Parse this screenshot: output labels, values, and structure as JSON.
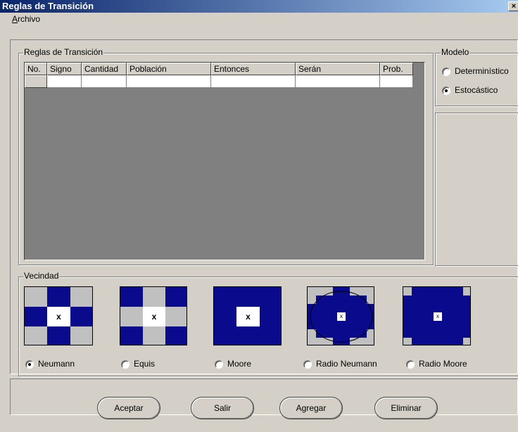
{
  "window": {
    "title": "Reglas de Transición",
    "close_glyph": "×"
  },
  "menu": {
    "archivo_accel": "A",
    "archivo_rest": "rchivo"
  },
  "rules": {
    "legend": "Reglas de Transición",
    "columns": [
      "No.",
      "Signo",
      "Cantidad",
      "Población",
      "Entonces",
      "Serán",
      "Prob."
    ]
  },
  "modelo": {
    "legend": "Modelo",
    "options": [
      {
        "label": "Determinístico",
        "selected": false
      },
      {
        "label": "Estocástico",
        "selected": true
      }
    ]
  },
  "vecindad": {
    "legend": "Vecindad",
    "center_mark": "x",
    "options": [
      {
        "label": "Neumann",
        "selected": true
      },
      {
        "label": "Equis",
        "selected": false
      },
      {
        "label": "Moore",
        "selected": false
      },
      {
        "label": "Radio Neumann",
        "selected": false
      },
      {
        "label": "Radio Moore",
        "selected": false
      }
    ]
  },
  "colors": {
    "blue": "#0a0a8c",
    "grey_cell": "#c0c0c0",
    "title_start": "#0a246a",
    "title_end": "#a6caf0"
  },
  "buttons": {
    "accept": "Aceptar",
    "exit": "Salir",
    "add": "Agregar",
    "delete": "Eliminar"
  }
}
